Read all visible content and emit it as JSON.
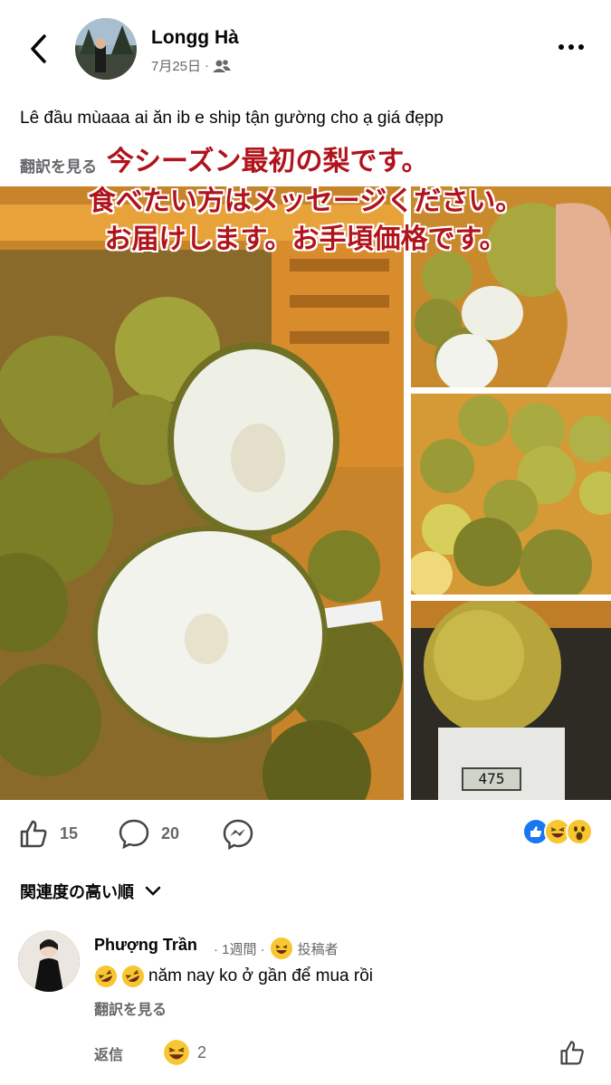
{
  "header": {
    "author": "Longg Hà",
    "date": "7月25日",
    "separator": "·",
    "back_icon": "chevron-left-icon",
    "privacy_icon": "friends-icon",
    "more_icon": "more-dots-icon"
  },
  "post": {
    "text": "Lê đầu mùaaa ai ăn ib e ship tận gường cho ạ giá đẹpp",
    "see_translation": "翻訳を見る",
    "overlay": {
      "line1": "今シーズン最初の梨です。",
      "line2": "食べたい方はメッセージください。",
      "line3": "お届けします。お手頃価格です。"
    },
    "scale_reading": "475"
  },
  "actions": {
    "like_count": "15",
    "comment_count": "20",
    "reactions": [
      "like-icon",
      "haha-icon",
      "wow-icon"
    ]
  },
  "comments": {
    "sort_label": "関連度の高い順",
    "items": [
      {
        "name": "Phượng Trần",
        "time": "· 1週間 ·",
        "badge": "投稿者",
        "text": "năm nay ko ở gần để mua rồi",
        "see_translation": "翻訳を見る",
        "reply": "返信",
        "reaction_count": "2"
      }
    ]
  },
  "colors": {
    "overlay_text": "#b0131b",
    "like_blue": "#1877f2",
    "muted": "#65676b"
  }
}
